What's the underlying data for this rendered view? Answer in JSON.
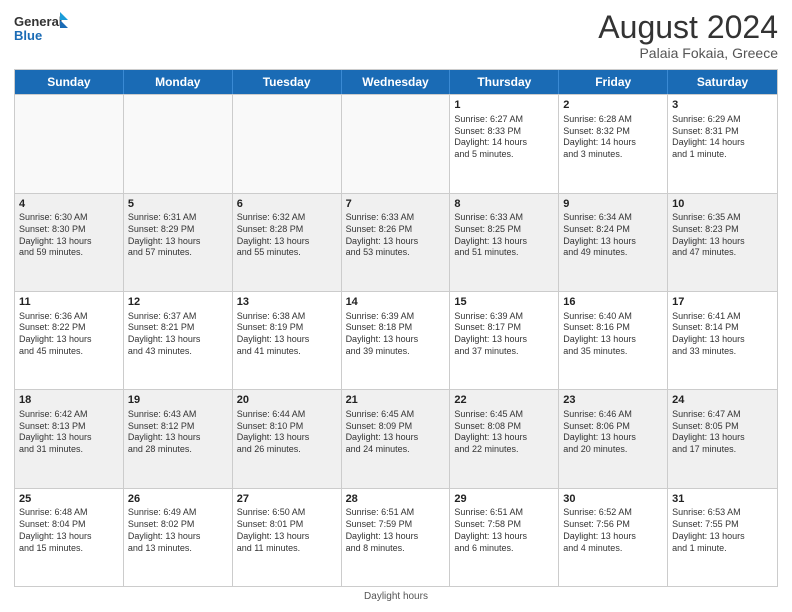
{
  "logo": {
    "line1": "General",
    "line2": "Blue"
  },
  "title": "August 2024",
  "subtitle": "Palaia Fokaia, Greece",
  "days_of_week": [
    "Sunday",
    "Monday",
    "Tuesday",
    "Wednesday",
    "Thursday",
    "Friday",
    "Saturday"
  ],
  "footer": "Daylight hours",
  "weeks": [
    [
      {
        "day": "",
        "info": "",
        "empty": true
      },
      {
        "day": "",
        "info": "",
        "empty": true
      },
      {
        "day": "",
        "info": "",
        "empty": true
      },
      {
        "day": "",
        "info": "",
        "empty": true
      },
      {
        "day": "1",
        "info": "Sunrise: 6:27 AM\nSunset: 8:33 PM\nDaylight: 14 hours\nand 5 minutes."
      },
      {
        "day": "2",
        "info": "Sunrise: 6:28 AM\nSunset: 8:32 PM\nDaylight: 14 hours\nand 3 minutes."
      },
      {
        "day": "3",
        "info": "Sunrise: 6:29 AM\nSunset: 8:31 PM\nDaylight: 14 hours\nand 1 minute."
      }
    ],
    [
      {
        "day": "4",
        "info": "Sunrise: 6:30 AM\nSunset: 8:30 PM\nDaylight: 13 hours\nand 59 minutes."
      },
      {
        "day": "5",
        "info": "Sunrise: 6:31 AM\nSunset: 8:29 PM\nDaylight: 13 hours\nand 57 minutes."
      },
      {
        "day": "6",
        "info": "Sunrise: 6:32 AM\nSunset: 8:28 PM\nDaylight: 13 hours\nand 55 minutes."
      },
      {
        "day": "7",
        "info": "Sunrise: 6:33 AM\nSunset: 8:26 PM\nDaylight: 13 hours\nand 53 minutes."
      },
      {
        "day": "8",
        "info": "Sunrise: 6:33 AM\nSunset: 8:25 PM\nDaylight: 13 hours\nand 51 minutes."
      },
      {
        "day": "9",
        "info": "Sunrise: 6:34 AM\nSunset: 8:24 PM\nDaylight: 13 hours\nand 49 minutes."
      },
      {
        "day": "10",
        "info": "Sunrise: 6:35 AM\nSunset: 8:23 PM\nDaylight: 13 hours\nand 47 minutes."
      }
    ],
    [
      {
        "day": "11",
        "info": "Sunrise: 6:36 AM\nSunset: 8:22 PM\nDaylight: 13 hours\nand 45 minutes."
      },
      {
        "day": "12",
        "info": "Sunrise: 6:37 AM\nSunset: 8:21 PM\nDaylight: 13 hours\nand 43 minutes."
      },
      {
        "day": "13",
        "info": "Sunrise: 6:38 AM\nSunset: 8:19 PM\nDaylight: 13 hours\nand 41 minutes."
      },
      {
        "day": "14",
        "info": "Sunrise: 6:39 AM\nSunset: 8:18 PM\nDaylight: 13 hours\nand 39 minutes."
      },
      {
        "day": "15",
        "info": "Sunrise: 6:39 AM\nSunset: 8:17 PM\nDaylight: 13 hours\nand 37 minutes."
      },
      {
        "day": "16",
        "info": "Sunrise: 6:40 AM\nSunset: 8:16 PM\nDaylight: 13 hours\nand 35 minutes."
      },
      {
        "day": "17",
        "info": "Sunrise: 6:41 AM\nSunset: 8:14 PM\nDaylight: 13 hours\nand 33 minutes."
      }
    ],
    [
      {
        "day": "18",
        "info": "Sunrise: 6:42 AM\nSunset: 8:13 PM\nDaylight: 13 hours\nand 31 minutes."
      },
      {
        "day": "19",
        "info": "Sunrise: 6:43 AM\nSunset: 8:12 PM\nDaylight: 13 hours\nand 28 minutes."
      },
      {
        "day": "20",
        "info": "Sunrise: 6:44 AM\nSunset: 8:10 PM\nDaylight: 13 hours\nand 26 minutes."
      },
      {
        "day": "21",
        "info": "Sunrise: 6:45 AM\nSunset: 8:09 PM\nDaylight: 13 hours\nand 24 minutes."
      },
      {
        "day": "22",
        "info": "Sunrise: 6:45 AM\nSunset: 8:08 PM\nDaylight: 13 hours\nand 22 minutes."
      },
      {
        "day": "23",
        "info": "Sunrise: 6:46 AM\nSunset: 8:06 PM\nDaylight: 13 hours\nand 20 minutes."
      },
      {
        "day": "24",
        "info": "Sunrise: 6:47 AM\nSunset: 8:05 PM\nDaylight: 13 hours\nand 17 minutes."
      }
    ],
    [
      {
        "day": "25",
        "info": "Sunrise: 6:48 AM\nSunset: 8:04 PM\nDaylight: 13 hours\nand 15 minutes."
      },
      {
        "day": "26",
        "info": "Sunrise: 6:49 AM\nSunset: 8:02 PM\nDaylight: 13 hours\nand 13 minutes."
      },
      {
        "day": "27",
        "info": "Sunrise: 6:50 AM\nSunset: 8:01 PM\nDaylight: 13 hours\nand 11 minutes."
      },
      {
        "day": "28",
        "info": "Sunrise: 6:51 AM\nSunset: 7:59 PM\nDaylight: 13 hours\nand 8 minutes."
      },
      {
        "day": "29",
        "info": "Sunrise: 6:51 AM\nSunset: 7:58 PM\nDaylight: 13 hours\nand 6 minutes."
      },
      {
        "day": "30",
        "info": "Sunrise: 6:52 AM\nSunset: 7:56 PM\nDaylight: 13 hours\nand 4 minutes."
      },
      {
        "day": "31",
        "info": "Sunrise: 6:53 AM\nSunset: 7:55 PM\nDaylight: 13 hours\nand 1 minute."
      }
    ]
  ]
}
